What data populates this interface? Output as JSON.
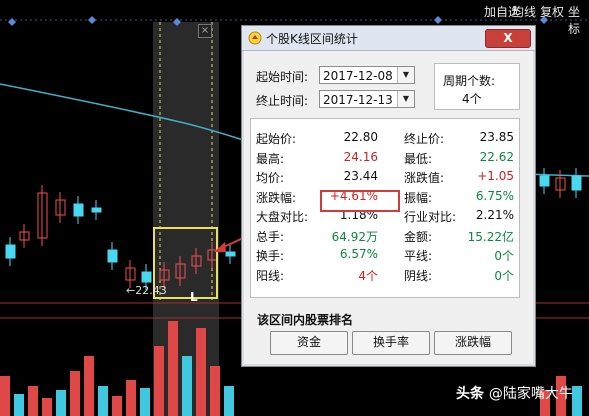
{
  "toolbar": {
    "items": [
      "加自选",
      "均线",
      "复权",
      "坐标"
    ]
  },
  "chart": {
    "close_label": "×",
    "price_low_label": "←22.43",
    "range_mark": "L",
    "colors": {
      "up": "#f05050",
      "down": "#48d8f0",
      "ma": "#3fb0c8",
      "volume_up": "#e04848",
      "volume_down": "#40c8e0",
      "selection": "#e8e060"
    }
  },
  "dialog": {
    "title": "个股K线区间统计",
    "close_label": "X",
    "start_label": "起始时间:",
    "start_value": "2017-12-08",
    "end_label": "终止时间:",
    "end_value": "2017-12-13",
    "period_label": "周期个数:",
    "period_value": "4个",
    "stats": [
      {
        "l1": "起始价:",
        "v1": "22.80",
        "c1": "black",
        "l2": "终止价:",
        "v2": "23.85",
        "c2": "black"
      },
      {
        "l1": "最高:",
        "v1": "24.16",
        "c1": "red",
        "l2": "最低:",
        "v2": "22.62",
        "c2": "green"
      },
      {
        "l1": "均价:",
        "v1": "23.44",
        "c1": "black",
        "l2": "涨跌值:",
        "v2": "+1.05",
        "c2": "red"
      },
      {
        "l1": "涨跌幅:",
        "v1": "+4.61%",
        "c1": "red",
        "l2": "振幅:",
        "v2": "6.75%",
        "c2": "green"
      },
      {
        "l1": "大盘对比:",
        "v1": "1.18%",
        "c1": "black",
        "l2": "行业对比:",
        "v2": "2.21%",
        "c2": "black"
      },
      {
        "l1": "总手:",
        "v1": "64.92万",
        "c1": "green",
        "l2": "金额:",
        "v2": "15.22亿",
        "c2": "green"
      },
      {
        "l1": "换手:",
        "v1": "6.57%",
        "c1": "green",
        "l2": "平线:",
        "v2": "0个",
        "c2": "green"
      },
      {
        "l1": "阳线:",
        "v1": "4个",
        "c1": "red",
        "l2": "阴线:",
        "v2": "0个",
        "c2": "green"
      }
    ],
    "ranking_title": "该区间内股票排名",
    "buttons": [
      "资金",
      "换手率",
      "涨跌幅"
    ]
  },
  "watermark": {
    "prefix": "头条 ",
    "text": "@陆家嘴大牛"
  }
}
